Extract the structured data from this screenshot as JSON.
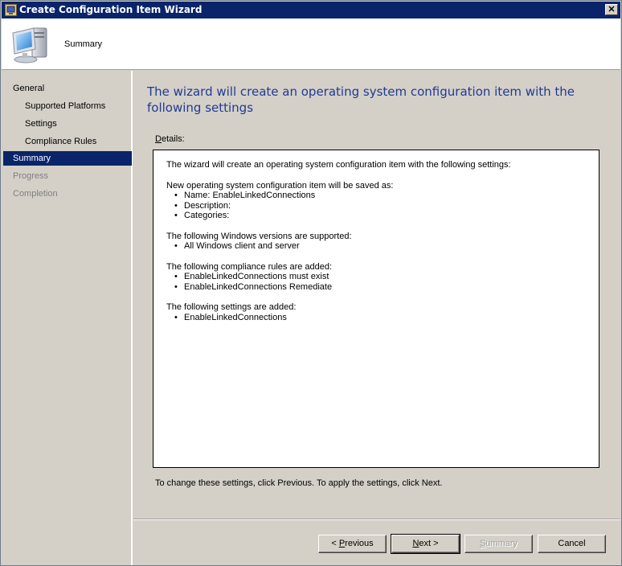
{
  "window": {
    "title": "Create Configuration Item Wizard",
    "close_glyph": "✕"
  },
  "header": {
    "title": "Summary",
    "icon": "computer-icon"
  },
  "sidebar": {
    "items": [
      {
        "label": "General",
        "state": "normal"
      },
      {
        "label": "Supported Platforms",
        "state": "normal"
      },
      {
        "label": "Settings",
        "state": "normal"
      },
      {
        "label": "Compliance Rules",
        "state": "normal"
      },
      {
        "label": "Summary",
        "state": "selected"
      },
      {
        "label": "Progress",
        "state": "disabled"
      },
      {
        "label": "Completion",
        "state": "disabled"
      }
    ]
  },
  "main": {
    "heading": "The wizard will create an operating system configuration item with the following settings",
    "details_label_mnemonic": "D",
    "details_label_rest": "etails:",
    "details": {
      "intro": "The wizard will create an operating system configuration item with the following settings:",
      "saved_as_header": "New operating system configuration item will be saved as:",
      "saved_as_items": [
        "Name: EnableLinkedConnections",
        "Description:",
        "Categories:"
      ],
      "versions_header": "The following Windows versions are supported:",
      "versions_items": [
        "All Windows client and server"
      ],
      "rules_header": "The following compliance rules are added:",
      "rules_items": [
        "EnableLinkedConnections must exist",
        "EnableLinkedConnections Remediate"
      ],
      "settings_header": "The following settings are added:",
      "settings_items": [
        "EnableLinkedConnections"
      ]
    },
    "footer_note": "To change these settings, click Previous. To apply the settings, click Next."
  },
  "buttons": {
    "previous_prefix": "< ",
    "previous_mnemonic": "P",
    "previous_rest": "revious",
    "next_mnemonic": "N",
    "next_rest": "ext >",
    "summary_mnemonic": "S",
    "summary_rest": "ummary",
    "cancel": "Cancel"
  },
  "colors": {
    "titlebar": "#0a246a",
    "heading_text": "#1f3a93",
    "selected_nav": "#0a246a",
    "disabled_text": "#808080"
  }
}
